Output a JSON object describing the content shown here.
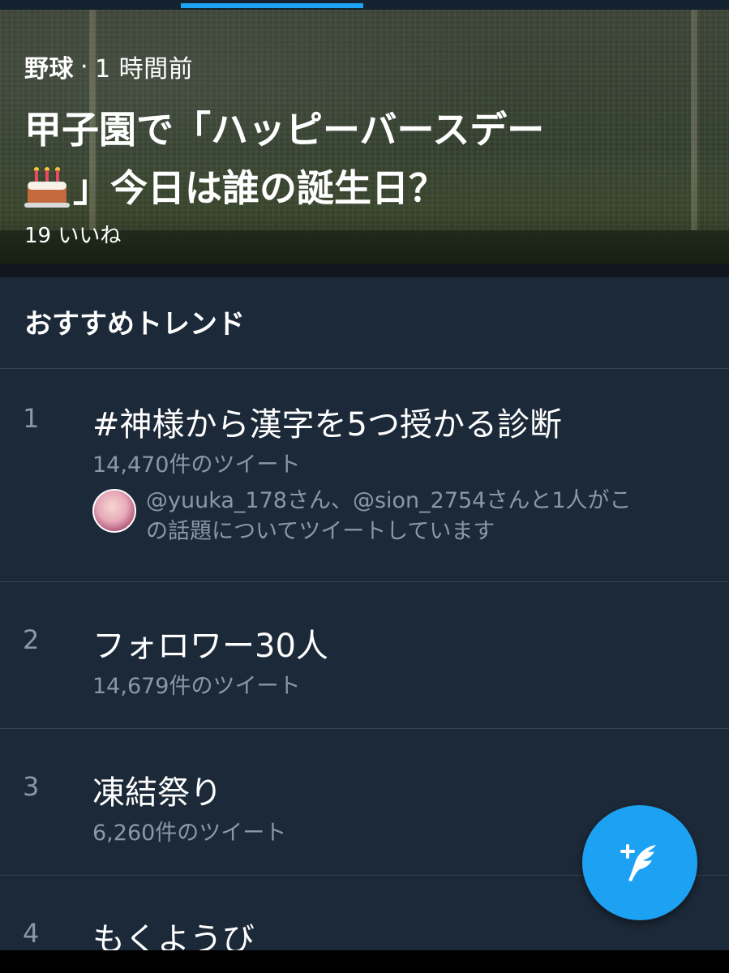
{
  "hero": {
    "category": "野球",
    "separator": "·",
    "time": "1 時間前",
    "headline_line1": "甲子園で「ハッピーバースデー",
    "headline_line2": "」今日は誰の誕生日？",
    "likes": "19 いいね",
    "inline_icon": "birthday-cake-icon"
  },
  "section": {
    "title": "おすすめトレンド"
  },
  "trends": [
    {
      "rank": "1",
      "name": "#神様から漢字を5つ授かる診断",
      "count": "14,470件のツイート",
      "context_line1": "@yuuka_178さん、@sion_2754さんと1人がこ",
      "context_line2": "の話題についてツイートしています"
    },
    {
      "rank": "2",
      "name": "フォロワー30人",
      "count": "14,679件のツイート"
    },
    {
      "rank": "3",
      "name": "凍結祭り",
      "count": "6,260件のツイート"
    },
    {
      "rank": "4",
      "name": "もくようび"
    }
  ],
  "fab": {
    "icon": "compose-tweet-icon"
  },
  "colors": {
    "background": "#1c2938",
    "accent": "#1da1f2",
    "secondary_text": "#8899a6",
    "divider": "#38444d"
  }
}
